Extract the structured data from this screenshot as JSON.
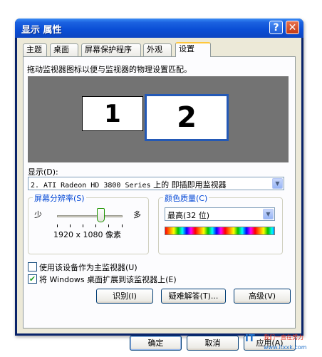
{
  "window": {
    "title": "显示 属性",
    "help_label": "?",
    "close_label": "✕"
  },
  "tabs": [
    "主题",
    "桌面",
    "屏幕保护程序",
    "外观",
    "设置"
  ],
  "settings": {
    "instructions": "拖动监视器图标以便与监视器的物理设置匹配。",
    "monitors": [
      "1",
      "2"
    ],
    "display_label": "显示(D):",
    "display_value_name": "2. ATI Radeon HD 3800 Series",
    "display_value_suffix": "上的 即插即用监视器",
    "resolution": {
      "title": "屏幕分辨率(S)",
      "less": "少",
      "more": "多",
      "value": "1920 x 1080 像素",
      "slider_fraction": 0.65
    },
    "color_quality": {
      "title": "颜色质量(C)",
      "value": "最高(32 位)"
    },
    "primary_checkbox": {
      "label": "使用该设备作为主监视器(U)",
      "checked": false
    },
    "extend_checkbox": {
      "label": "将 Windows 桌面扩展到该监视器上(E)",
      "checked": true
    },
    "buttons": {
      "identify": "识别(I)",
      "troubleshoot": "疑难解答(T)...",
      "advanced": "高级(V)"
    }
  },
  "footer": {
    "ok": "确定",
    "cancel": "取消",
    "apply": "应用(A)"
  },
  "watermark": {
    "logo": "IT",
    "slogan": "我们一直在努力",
    "url": "www.itxxk.com"
  },
  "colors": {
    "titlebar": "#0b4fd6",
    "group_title": "#0046d5",
    "selected_monitor_border": "#2459b6",
    "monitor_area": "#737373"
  }
}
